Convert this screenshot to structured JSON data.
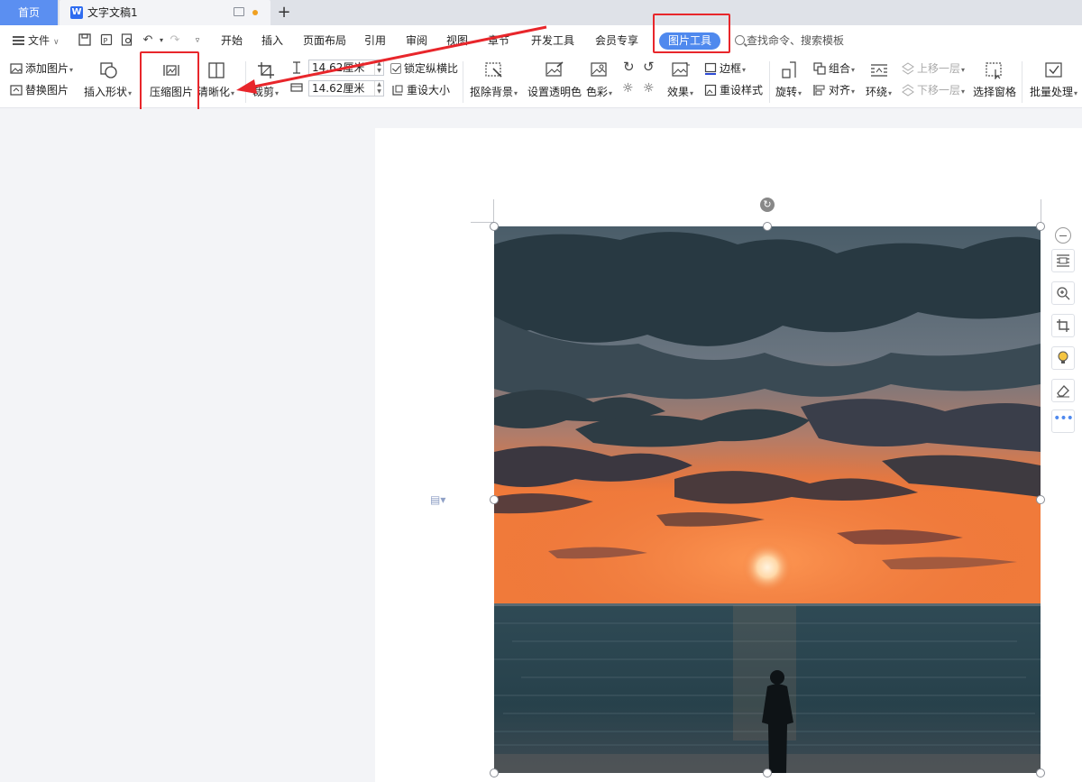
{
  "tabbar": {
    "home_tab": "首页",
    "doc_tab": "文字文稿1",
    "doc_icon_letter": "W",
    "add_tab": "+"
  },
  "menubar": {
    "file": "文件",
    "tabs": [
      "开始",
      "插入",
      "页面布局",
      "引用",
      "审阅",
      "视图",
      "章节",
      "开发工具",
      "会员专享"
    ],
    "active_tab": "图片工具",
    "search_placeholder": "查找命令、搜索模板"
  },
  "ribbon": {
    "add_picture": "添加图片",
    "replace_picture": "替换图片",
    "insert_shape": "插入形状",
    "compress_picture": "压缩图片",
    "sharpen": "清晰化",
    "crop": "裁剪",
    "height_value": "14.62厘米",
    "width_value": "14.62厘米",
    "lock_aspect": "锁定纵横比",
    "reset_size": "重设大小",
    "remove_background": "抠除背景",
    "set_transparent": "设置透明色",
    "color": "色彩",
    "border": "边框",
    "effects": "效果",
    "reset_style": "重设样式",
    "rotate": "旋转",
    "group": "组合",
    "align": "对齐",
    "wrap": "环绕",
    "bring_forward": "上移一层",
    "send_backward": "下移一层",
    "selection_pane": "选择窗格",
    "batch_process": "批量处理"
  },
  "colors": {
    "accent": "#4f89ee",
    "annotation_red": "#e8262b",
    "tab_home_bg": "#5b8ff1"
  },
  "icons": [
    "hamburger-icon",
    "save-icon",
    "export-icon",
    "print-preview-icon",
    "undo-icon",
    "redo-icon",
    "customize-icon",
    "search-icon",
    "rotate-handle-icon",
    "document-float-icon",
    "minus-icon",
    "wrap-layout-icon",
    "zoom-in-icon",
    "crop-icon",
    "bulb-icon",
    "eraser-icon",
    "more-icon"
  ]
}
